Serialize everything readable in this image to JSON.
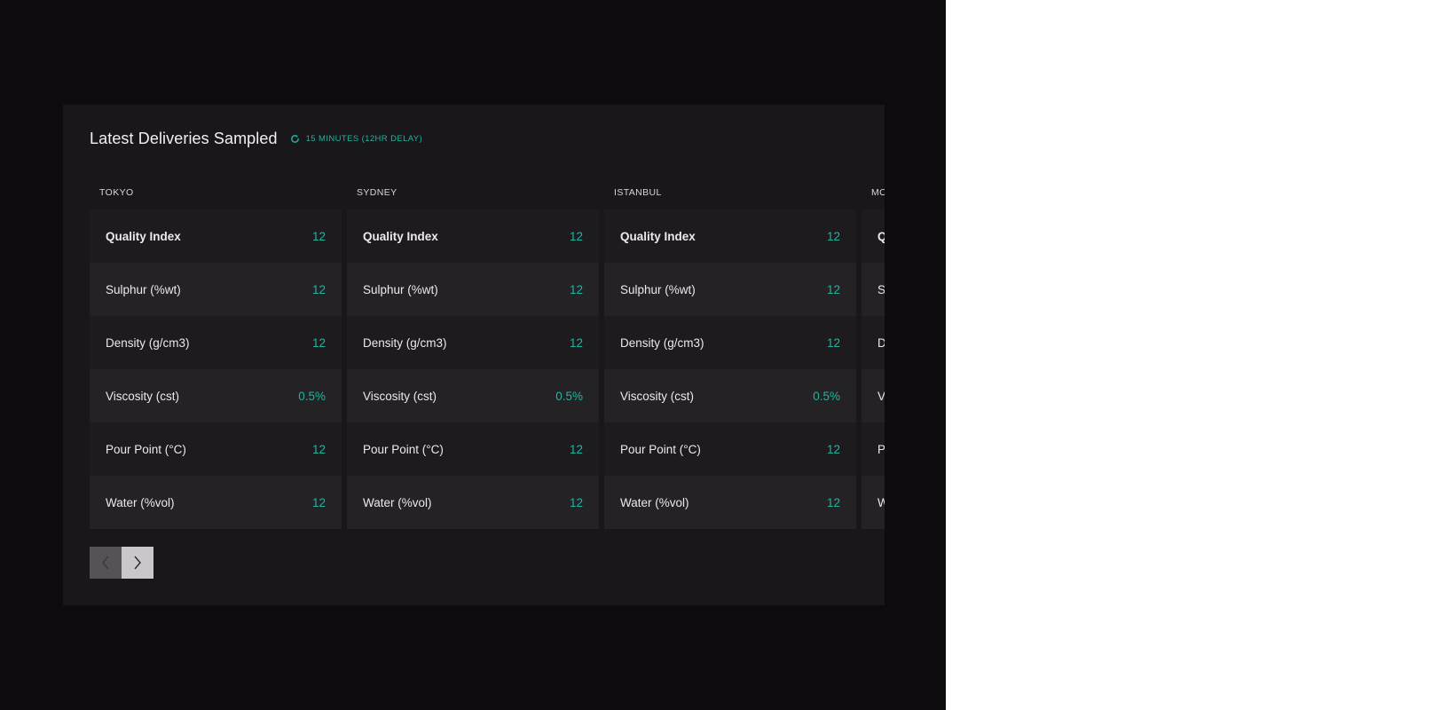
{
  "panel": {
    "title": "Latest Deliveries Sampled",
    "refresh_label": "15 MINUTES (12HR DELAY)"
  },
  "cities": [
    {
      "name": "TOKYO",
      "rows": [
        {
          "label": "Quality Index",
          "value": "12"
        },
        {
          "label": "Sulphur (%wt)",
          "value": "12"
        },
        {
          "label": "Density (g/cm3)",
          "value": "12"
        },
        {
          "label": "Viscosity (cst)",
          "value": "0.5%"
        },
        {
          "label": "Pour Point (°C)",
          "value": "12"
        },
        {
          "label": "Water (%vol)",
          "value": "12"
        }
      ]
    },
    {
      "name": "SYDNEY",
      "rows": [
        {
          "label": "Quality Index",
          "value": "12"
        },
        {
          "label": "Sulphur (%wt)",
          "value": "12"
        },
        {
          "label": "Density (g/cm3)",
          "value": "12"
        },
        {
          "label": "Viscosity (cst)",
          "value": "0.5%"
        },
        {
          "label": "Pour Point (°C)",
          "value": "12"
        },
        {
          "label": "Water (%vol)",
          "value": "12"
        }
      ]
    },
    {
      "name": "ISTANBUL",
      "rows": [
        {
          "label": "Quality Index",
          "value": "12"
        },
        {
          "label": "Sulphur (%wt)",
          "value": "12"
        },
        {
          "label": "Density (g/cm3)",
          "value": "12"
        },
        {
          "label": "Viscosity (cst)",
          "value": "0.5%"
        },
        {
          "label": "Pour Point (°C)",
          "value": "12"
        },
        {
          "label": "Water (%vol)",
          "value": "12"
        }
      ]
    },
    {
      "name": "MO",
      "rows": [
        {
          "label": "Q",
          "value": ""
        },
        {
          "label": "S",
          "value": ""
        },
        {
          "label": "D",
          "value": ""
        },
        {
          "label": "V",
          "value": ""
        },
        {
          "label": "P",
          "value": ""
        },
        {
          "label": "W",
          "value": ""
        }
      ]
    }
  ],
  "pager": {
    "prev_icon": "chevron-left-icon",
    "next_icon": "chevron-right-icon"
  },
  "colors": {
    "accent": "#1fb59f",
    "panel_bg": "#19171a",
    "page_bg": "#0e0b0f"
  }
}
